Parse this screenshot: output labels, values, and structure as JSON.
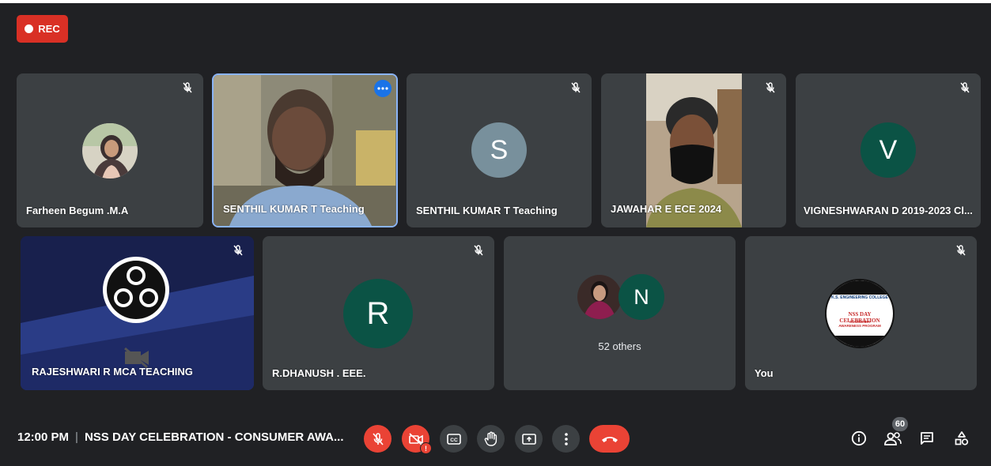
{
  "recording": {
    "label": "REC",
    "color": "#d93025"
  },
  "tiles": [
    {
      "name": "Farheen Begum .M.A",
      "type": "photo"
    },
    {
      "name": "SENTHIL KUMAR T Teaching",
      "type": "video",
      "active": true
    },
    {
      "name": "SENTHIL KUMAR T Teaching",
      "type": "letter",
      "letter": "S",
      "avatar_color": "#78909c"
    },
    {
      "name": "JAWAHAR E ECE 2024",
      "type": "video"
    },
    {
      "name": "VIGNESHWARAN D 2019-2023 Cl...",
      "type": "letter",
      "letter": "V",
      "avatar_color": "#0b5345"
    },
    {
      "name": "RAJESHWARI R MCA TEACHING",
      "type": "obs"
    },
    {
      "name": "R.DHANUSH . EEE.",
      "type": "letter",
      "letter": "R",
      "avatar_color": "#0b5345"
    },
    {
      "name": "",
      "type": "others",
      "letter": "N",
      "others_label": "52 others",
      "avatar_color": "#0b5345"
    },
    {
      "name": "You",
      "type": "poster"
    }
  ],
  "poster": {
    "college": "K.S. ENGINEERING COLLEGE",
    "event": "NSS DAY CELEBRATION",
    "subtitle": "CONSUMER AWARENESS PROGRAM"
  },
  "bottom_bar": {
    "time": "12:00 PM",
    "meeting_title": "NSS DAY CELEBRATION - CONSUMER AWA...",
    "participant_count": "60",
    "controls": [
      "mic-off",
      "camera-off",
      "captions",
      "raise-hand",
      "present",
      "more-options",
      "end-call"
    ],
    "right_controls": [
      "info",
      "people",
      "chat",
      "activities"
    ]
  },
  "colors": {
    "background": "#202124",
    "tile": "#3c4043",
    "danger": "#ea4335",
    "active_border": "#8ab4f8"
  }
}
